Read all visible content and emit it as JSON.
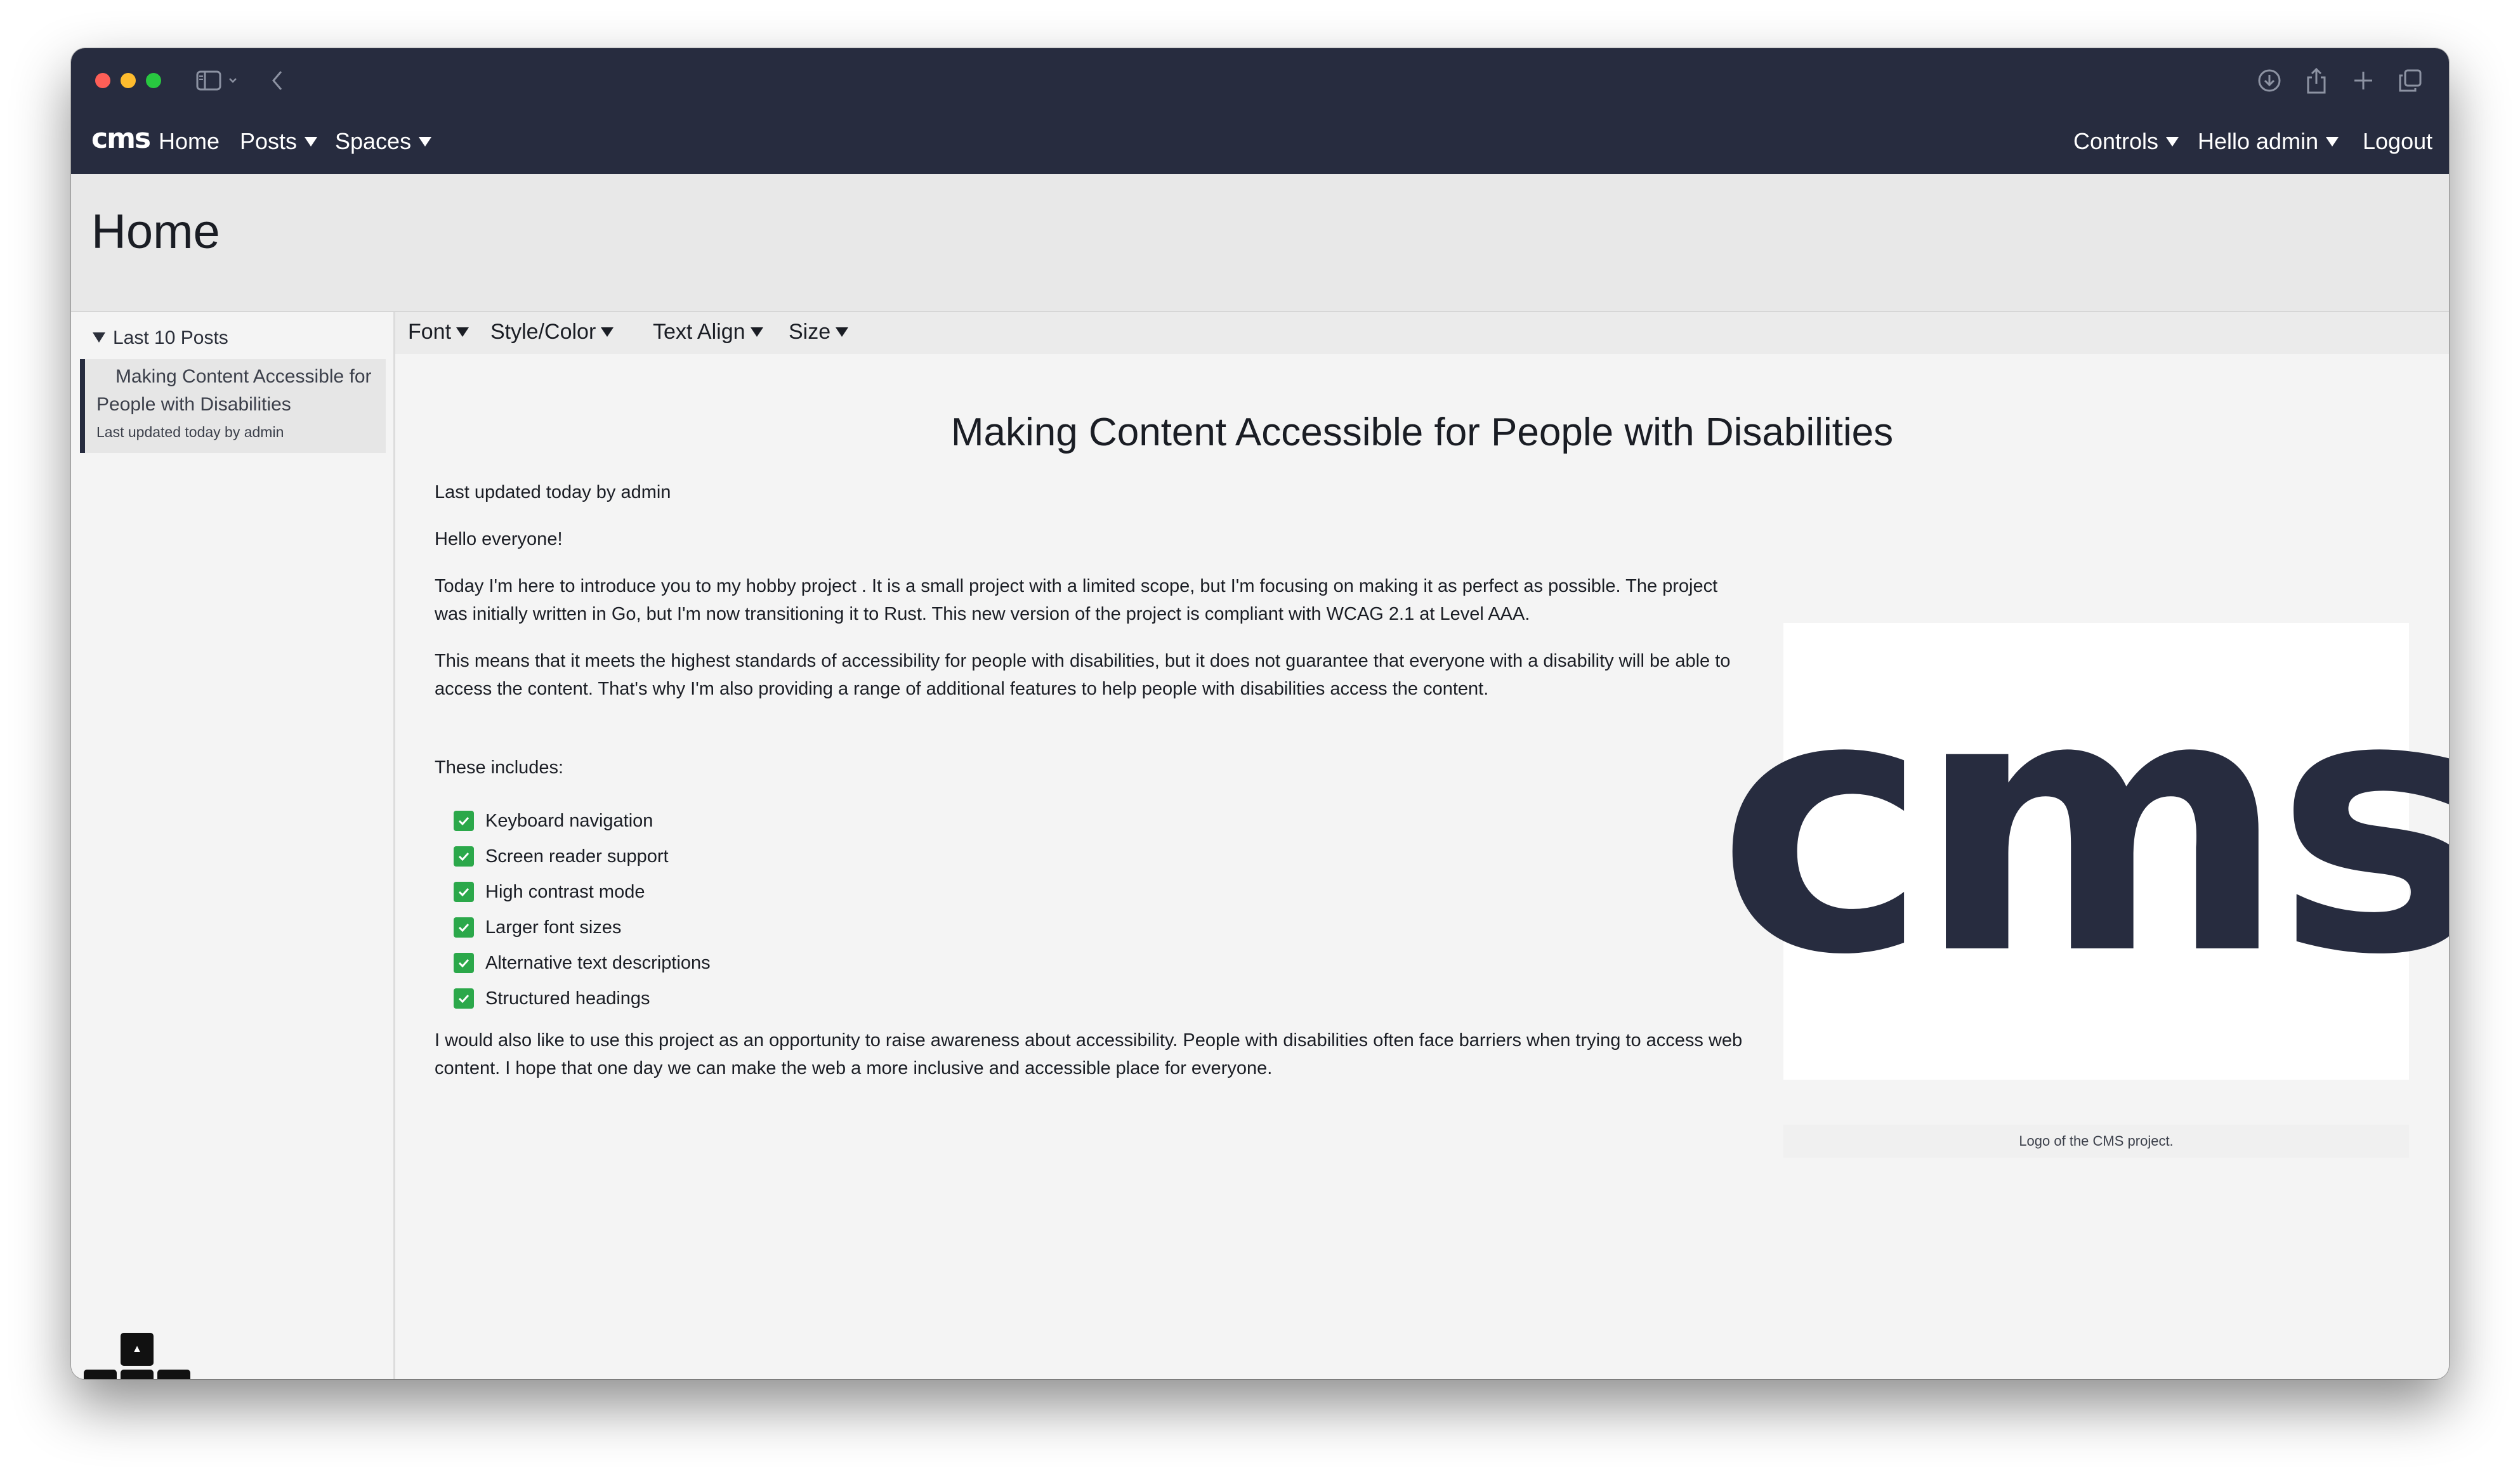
{
  "browser": {
    "traffic_lights": [
      "#fe5f57",
      "#febc2e",
      "#28c840"
    ],
    "toolbar_icons": [
      "sidebar-icon",
      "chevron-down-icon",
      "back-icon",
      "download-icon",
      "share-icon",
      "new-tab-icon",
      "tabs-overview-icon"
    ]
  },
  "navbar": {
    "brand": "cms",
    "left_items": [
      {
        "label": "Home"
      },
      {
        "label": "Posts"
      },
      {
        "label": "Spaces"
      }
    ],
    "right_items": [
      {
        "label": "Controls"
      },
      {
        "label": "Hello admin"
      },
      {
        "label": "Logout"
      }
    ]
  },
  "page": {
    "title": "Home"
  },
  "sidebar": {
    "section_label": "Last 10 Posts",
    "posts": [
      {
        "title": "Making Content Accessible for People with Disabilities",
        "meta": "Last updated today by admin"
      }
    ]
  },
  "arrow_keys": {
    "up": "▲",
    "left": "◄",
    "down": "▼",
    "right": "►"
  },
  "toolbar": {
    "items": [
      "Font",
      "Style/Color",
      "Text Align",
      "Size"
    ]
  },
  "post": {
    "title": "Making Content Accessible for People with Disabilities",
    "meta": "Last updated today by admin",
    "greeting": "Hello everyone!",
    "paragraph1": "Today I'm here to introduce you to my hobby project . It is a small project with a limited scope, but I'm focusing on making it as perfect as possible. The project was initially written in Go, but I'm now transitioning it to Rust. This new version of the project is compliant with WCAG 2.1 at Level AAA.",
    "paragraph2": "This means that it meets the highest standards of accessibility for people with disabilities, but it does not guarantee that everyone with a disability will be able to access the content. That's why I'm also providing a range of additional features to help people with disabilities access the content.",
    "list_intro": "These includes:",
    "features": [
      "Keyboard navigation",
      "Screen reader support",
      "High contrast mode",
      "Larger font sizes",
      "Alternative text descriptions",
      "Structured headings"
    ],
    "paragraph3": "I would also like to use this project as an opportunity to raise awareness about accessibility. People with disabilities often face barriers when trying to access web content. I hope that one day we can make the web a more inclusive and accessible place for everyone.",
    "figure_logo_text": "cms",
    "figure_caption": "Logo of the CMS project."
  },
  "colors": {
    "navbar_bg": "#272c3f",
    "checkbox_green": "#2ba84a",
    "content_bg": "#f4f4f4"
  }
}
